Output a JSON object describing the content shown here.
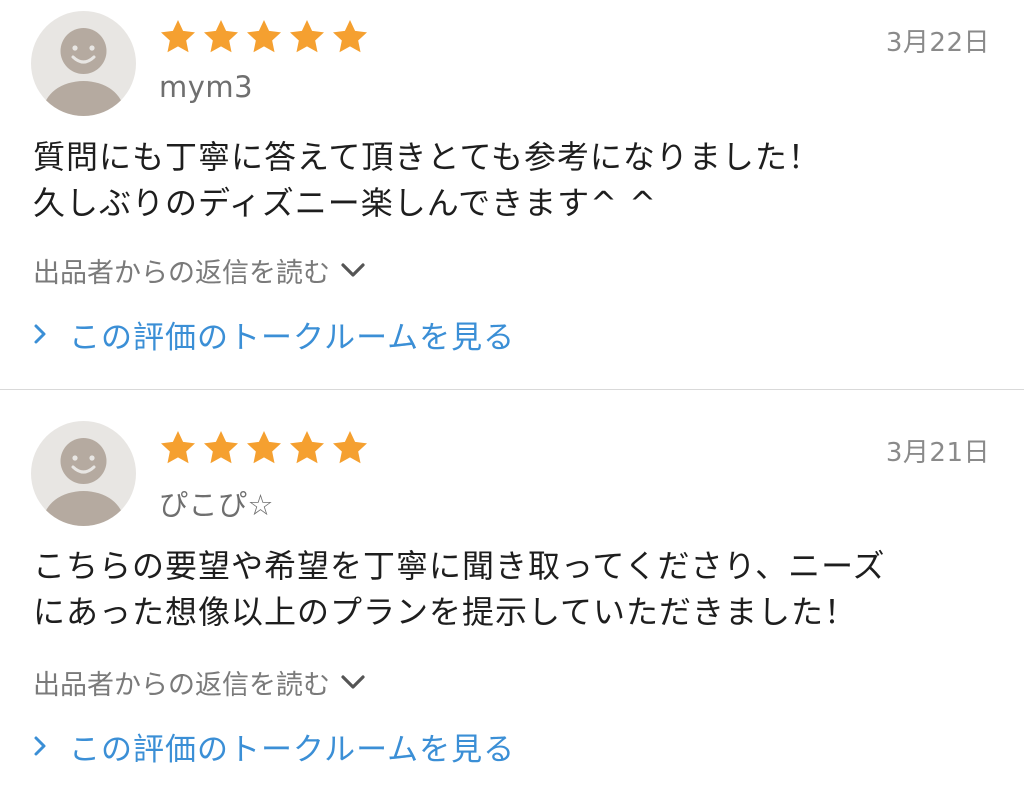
{
  "colors": {
    "star": "#f5a030",
    "link": "#3b8fd6",
    "muted_text": "#7a7a7a",
    "avatar_bg": "#e8e6e3",
    "avatar_fg": "#b5aaa0",
    "divider": "#d9d9d9"
  },
  "reviews": [
    {
      "rating": 5,
      "date": "3月22日",
      "username": "mym3",
      "comment_lines": [
        "質問にも丁寧に答えて頂きとても参考になりました！",
        "久しぶりのディズニー楽しんできます^ ^"
      ],
      "reply_toggle_label": "出品者からの返信を読む",
      "reply_toggle_icon": "chevron-down-icon",
      "talkroom_label": "この評価のトークルームを見る",
      "talkroom_icon": "chevron-right-icon"
    },
    {
      "rating": 5,
      "date": "3月21日",
      "username": "ぴこぴ☆",
      "comment_lines": [
        "こちらの要望や希望を丁寧に聞き取ってくださり、ニーズ",
        "にあった想像以上のプランを提示していただきました！"
      ],
      "reply_toggle_label": "出品者からの返信を読む",
      "reply_toggle_icon": "chevron-down-icon",
      "talkroom_label": "この評価のトークルームを見る",
      "talkroom_icon": "chevron-right-icon"
    }
  ]
}
